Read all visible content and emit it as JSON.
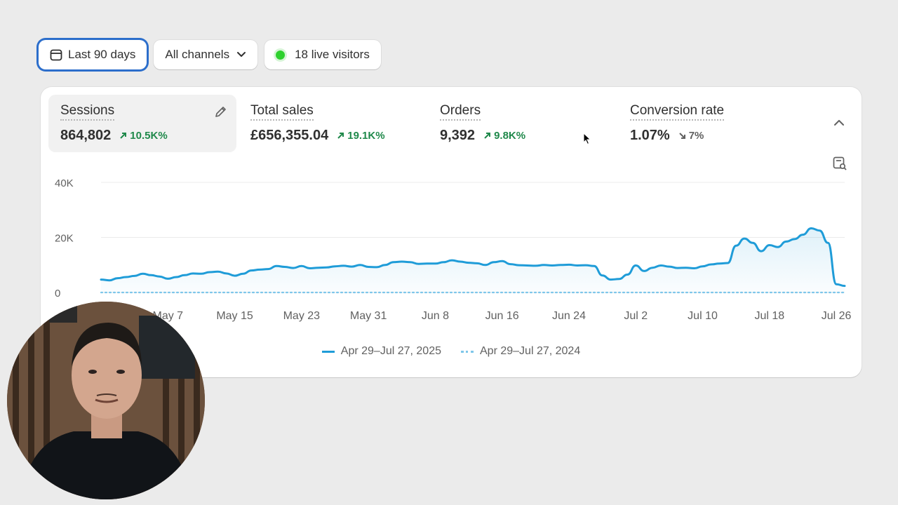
{
  "filters": {
    "date_range": "Last 90 days",
    "channel": "All channels",
    "live_visitors": "18 live visitors"
  },
  "metrics": [
    {
      "label": "Sessions",
      "value": "864,802",
      "delta": "10.5K%",
      "direction": "up"
    },
    {
      "label": "Total sales",
      "value": "£656,355.04",
      "delta": "19.1K%",
      "direction": "up"
    },
    {
      "label": "Orders",
      "value": "9,392",
      "delta": "9.8K%",
      "direction": "up"
    },
    {
      "label": "Conversion rate",
      "value": "1.07%",
      "delta": "7%",
      "direction": "down"
    }
  ],
  "colors": {
    "current": "#1f9cd8",
    "previous": "#7fc7ea",
    "up": "#20894b",
    "accent": "#2c6ecb"
  },
  "chart_data": {
    "type": "area",
    "ylim": [
      0,
      40000
    ],
    "y_ticks": [
      {
        "label": "40K",
        "value": 40000
      },
      {
        "label": "20K",
        "value": 20000
      },
      {
        "label": "0",
        "value": 0
      }
    ],
    "x_ticks": [
      "May 7",
      "May 15",
      "May 23",
      "May 31",
      "Jun 8",
      "Jun 16",
      "Jun 24",
      "Jul 2",
      "Jul 10",
      "Jul 18",
      "Jul 26"
    ],
    "x_tick_days": [
      8,
      16,
      24,
      32,
      40,
      48,
      56,
      64,
      72,
      80,
      88
    ],
    "x_domain_days": [
      0,
      89
    ],
    "grid": true,
    "legend_position": "bottom",
    "series": [
      {
        "name": "Apr 29–Jul 27, 2025",
        "style": "solid",
        "values": [
          4700,
          4400,
          5200,
          5600,
          6000,
          6800,
          6300,
          5800,
          5000,
          5600,
          6300,
          6900,
          6800,
          7400,
          7600,
          6900,
          6100,
          6800,
          8000,
          8300,
          8500,
          9600,
          9300,
          8900,
          9600,
          8800,
          9000,
          9100,
          9500,
          9700,
          9400,
          10000,
          9300,
          9200,
          10000,
          11000,
          11200,
          11000,
          10400,
          10500,
          10500,
          11000,
          11700,
          11200,
          10800,
          10600,
          10000,
          11000,
          11400,
          10300,
          9900,
          9800,
          9700,
          10000,
          9800,
          10000,
          10100,
          9800,
          9900,
          9600,
          6200,
          4700,
          4900,
          6500,
          9800,
          7800,
          9000,
          9800,
          9400,
          8900,
          9000,
          8800,
          9500,
          10200,
          10500,
          10700,
          17000,
          19600,
          18000,
          15000,
          17200,
          16500,
          18500,
          19400,
          21000,
          23300,
          22500,
          18000,
          3000,
          2400
        ]
      },
      {
        "name": "Apr 29–Jul 27, 2024",
        "style": "dotted",
        "values": [
          0,
          0,
          0,
          0,
          0,
          0,
          0,
          0,
          0,
          0,
          0,
          0,
          0,
          0,
          0,
          0,
          0,
          0,
          0,
          0,
          0,
          0,
          0,
          0,
          0,
          0,
          0,
          0,
          0,
          0,
          0,
          0,
          0,
          0,
          0,
          0,
          0,
          0,
          0,
          0,
          0,
          0,
          0,
          0,
          0,
          0,
          0,
          0,
          0,
          0,
          0,
          0,
          0,
          0,
          0,
          0,
          0,
          0,
          0,
          0,
          0,
          0,
          0,
          0,
          0,
          0,
          0,
          0,
          0,
          0,
          0,
          0,
          0,
          0,
          0,
          0,
          0,
          0,
          0,
          0,
          0,
          0,
          0,
          0,
          0,
          0,
          0,
          0,
          0,
          0
        ]
      }
    ]
  }
}
